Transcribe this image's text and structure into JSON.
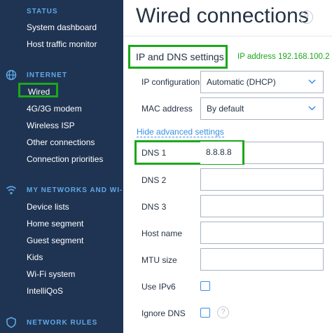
{
  "sidebar": {
    "status": {
      "heading": "STATUS",
      "items": [
        "System dashboard",
        "Host traffic monitor"
      ]
    },
    "internet": {
      "heading": "INTERNET",
      "icon": "globe-icon",
      "items": [
        "Wired",
        "4G/3G modem",
        "Wireless ISP",
        "Other connections",
        "Connection priorities"
      ]
    },
    "networks": {
      "heading": "MY NETWORKS AND WI-FI",
      "icon": "wifi-icon",
      "items": [
        "Device lists",
        "Home segment",
        "Guest segment",
        "Kids",
        "Wi-Fi system",
        "IntelliQoS"
      ]
    },
    "rules": {
      "heading": "NETWORK RULES",
      "icon": "shield-icon"
    }
  },
  "page": {
    "title": "Wired connections",
    "help_mark": "?"
  },
  "settings": {
    "section_title": "IP and DNS settings",
    "ip_address_text": "IP address 192.168.100.2",
    "ip_config_label": "IP configuration",
    "ip_config_value": "Automatic (DHCP)",
    "mac_label": "MAC address",
    "mac_value": "By default",
    "advanced_link": "Hide advanced settings",
    "dns1_label": "DNS 1",
    "dns1_value": "8.8.8.8",
    "dns2_label": "DNS 2",
    "dns2_value": "",
    "dns3_label": "DNS 3",
    "dns3_value": "",
    "hostname_label": "Host name",
    "hostname_value": "",
    "mtu_label": "MTU size",
    "mtu_value": "",
    "use_ipv6_label": "Use IPv6",
    "use_ipv6_checked": false,
    "ignore_dns_label": "Ignore DNS",
    "ignore_dns_checked": false,
    "ignore_dns_help": "?"
  },
  "colors": {
    "sidebar_bg": "#1f3452",
    "section_heading": "#5fa8e8",
    "highlight": "#1ba81b",
    "link": "#3a8ee6"
  }
}
